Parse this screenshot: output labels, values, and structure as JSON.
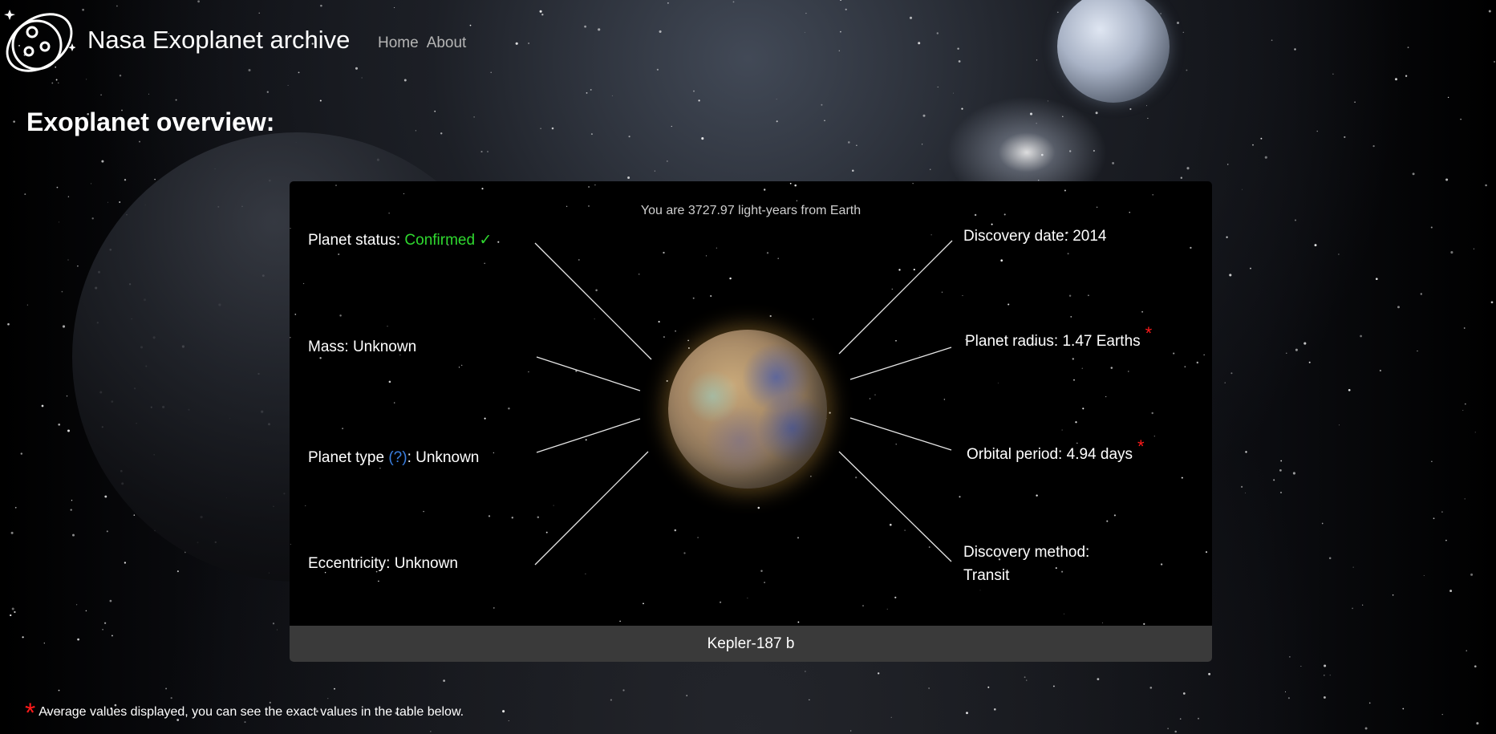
{
  "header": {
    "brand": "Nasa Exoplanet archive",
    "nav": [
      {
        "label": "Home"
      },
      {
        "label": "About"
      }
    ],
    "logo_icon": "planet-logo-icon"
  },
  "page_title": "Exoplanet overview:",
  "overview": {
    "distance": {
      "prefix": "You are ",
      "value": "3727.97",
      "suffix": " light-years from Earth"
    },
    "planet_status": {
      "label": "Planet status: ",
      "value": "Confirmed ✓"
    },
    "mass": {
      "label": "Mass: ",
      "value": "Unknown"
    },
    "planet_type": {
      "label": "Planet type ",
      "help": "(?)",
      "sep": ": ",
      "value": "Unknown"
    },
    "eccentricity": {
      "label": "Eccentricity: ",
      "value": "Unknown"
    },
    "discovery_date": {
      "label": "Discovery date: ",
      "value": "2014"
    },
    "planet_radius": {
      "label": "Planet radius: ",
      "value": "1.47 Earths",
      "marker": "*"
    },
    "orbital_period": {
      "label": "Orbital period: ",
      "value": "4.94 days",
      "marker": "*"
    },
    "discovery_method": {
      "label": "Discovery method:",
      "value": "Transit"
    },
    "planet_name": "Kepler-187 b"
  },
  "footnote": {
    "marker": "*",
    "text": "Average values displayed, you can see the exact values in the table below."
  },
  "colors": {
    "confirmed": "#2fd82f",
    "help_link": "#3b7fe0",
    "asterisk": "#ff1a1a",
    "footer_bar": "#3a3a3a"
  }
}
